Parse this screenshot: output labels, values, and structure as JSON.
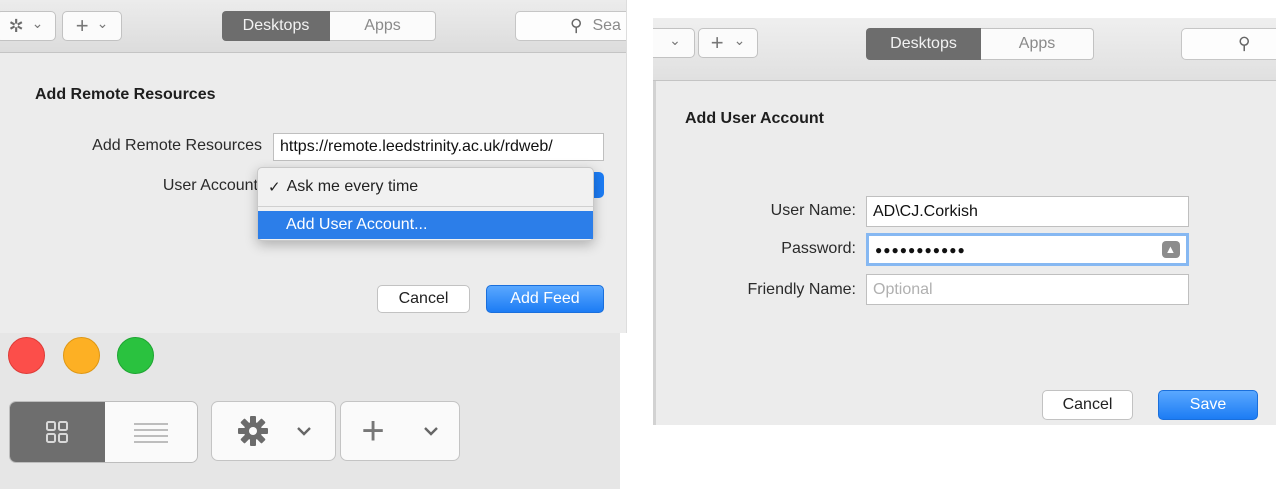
{
  "panel_a": {
    "toolbar": {
      "gear_caret": "⌄",
      "plus": "+",
      "plus_caret": "⌄",
      "tab_desktops": "Desktops",
      "tab_apps": "Apps",
      "search_placeholder": "Sea"
    },
    "sheet": {
      "title": "Add Remote Resources",
      "url_label": "Add Remote Resources",
      "url_value": "https://remote.leedstrinity.ac.uk/rdweb/",
      "account_label": "User Account",
      "menu": {
        "check": "✓",
        "item_ask": "Ask me every time",
        "item_add": "Add User Account..."
      },
      "cancel": "Cancel",
      "add_feed": "Add Feed"
    }
  },
  "panel_b": {
    "toolbar": {
      "tab_desktops": "Desktops",
      "tab_apps": "Apps"
    },
    "sheet": {
      "title": "Add User Account",
      "user_name_label": "User Name:",
      "user_name_value": "AD\\CJ.Corkish",
      "password_label": "Password:",
      "password_value": "●●●●●●●●●●●",
      "friendly_label": "Friendly Name:",
      "friendly_placeholder": "Optional",
      "cancel": "Cancel",
      "save": "Save"
    }
  },
  "panel_c": {
    "window_controls": {
      "close_color": "#fc4e4a",
      "minimize_color": "#fdb024",
      "zoom_color": "#2ac23f"
    },
    "plus": "+"
  },
  "colors": {
    "accent_blue": "#1c7cf4",
    "menu_highlight": "#2c7ee9",
    "segment_active": "#6d6d6d"
  }
}
